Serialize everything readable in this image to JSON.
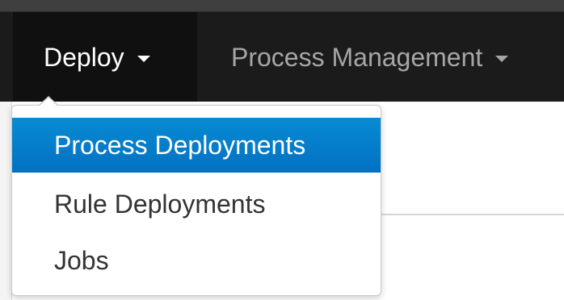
{
  "navbar": {
    "deploy_label": "Deploy",
    "process_management_label": "Process Management"
  },
  "dropdown": {
    "items": [
      {
        "label": "Process Deployments"
      },
      {
        "label": "Rule Deployments"
      },
      {
        "label": "Jobs"
      }
    ]
  },
  "colors": {
    "navbar_background": "#1b1b1b",
    "active_nav_background": "#101010",
    "selected_menu_item": "#0477c9",
    "menu_text": "#333333",
    "inactive_nav_text": "#a6a6a6"
  },
  "icons": {
    "deploy_caret": "chevron-down-icon",
    "process_management_caret": "chevron-down-icon"
  }
}
